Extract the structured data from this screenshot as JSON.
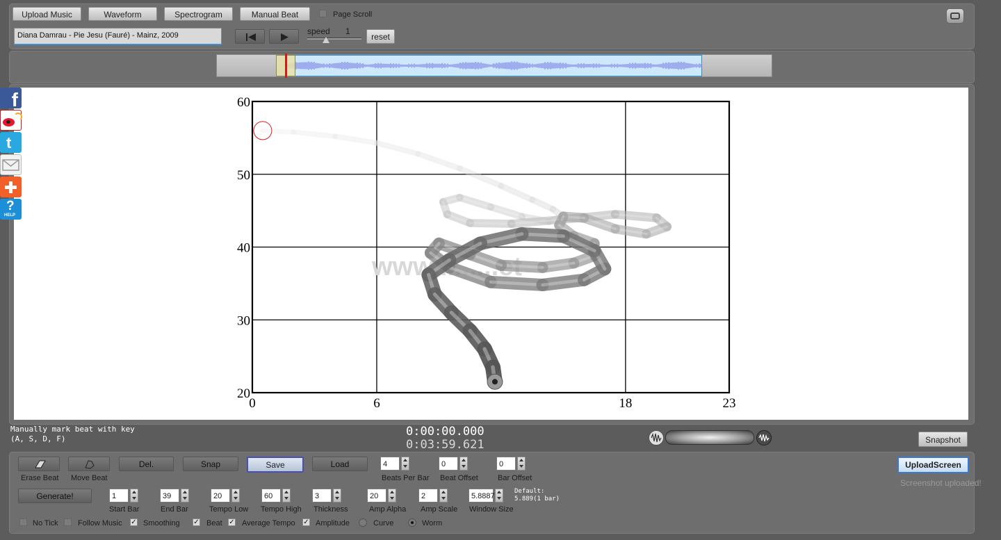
{
  "toolbar": {
    "upload_music": "Upload Music",
    "waveform": "Waveform",
    "spectrogram": "Spectrogram",
    "manual_beat": "Manual Beat",
    "page_scroll": "Page Scroll",
    "track_title": "Diana Damrau - Pie Jesu (Fauré) - Mainz, 2009",
    "speed_label": "speed",
    "speed_value": "1",
    "reset": "reset"
  },
  "chart_data": {
    "type": "line",
    "title": "",
    "xlabel": "",
    "ylabel": "",
    "xlim": [
      0,
      23
    ],
    "ylim": [
      20,
      60
    ],
    "x_ticks": [
      "0",
      "6",
      "18",
      "23"
    ],
    "y_ticks": [
      "60",
      "50",
      "40",
      "30",
      "20"
    ],
    "grid": true,
    "watermark": "www.........et",
    "series": [
      {
        "x": [
          0.5,
          2,
          4,
          6,
          8,
          10,
          12,
          13.5,
          14.5,
          15,
          14.3,
          13,
          11.5,
          10,
          9.2,
          9.4,
          10.5,
          12.5,
          15,
          17.5,
          19.5,
          20,
          19,
          17.5,
          16,
          15,
          14.8,
          15.5,
          16.5,
          16.5,
          15.5,
          14,
          12,
          10.5,
          9,
          8.6,
          9.5,
          11.5,
          14,
          16,
          17,
          16.5,
          15,
          13,
          11,
          9.5,
          8.5,
          8.8,
          9.6,
          10.5,
          11.2,
          11.6,
          11.7
        ],
        "y": [
          56,
          55.8,
          55.2,
          54.3,
          52.8,
          50.8,
          48.4,
          46.5,
          45.2,
          44.2,
          43.5,
          44.2,
          45.5,
          46.8,
          46.2,
          44.5,
          43.3,
          43.2,
          43.8,
          44.5,
          44,
          42.8,
          41.8,
          42.5,
          44,
          44.2,
          43,
          41.5,
          40.5,
          38.8,
          37.8,
          37.2,
          37.5,
          39,
          40.5,
          39.2,
          37.2,
          35.2,
          34.8,
          35.5,
          37,
          39.5,
          41.5,
          41.8,
          40.5,
          38.2,
          36.2,
          33.5,
          31,
          28.5,
          26,
          23.5,
          21.5
        ]
      }
    ]
  },
  "status": {
    "hint_line1": "Manually mark beat with key",
    "hint_line2": "(A, S, D, F)",
    "time_current": "0:00:00.000",
    "time_total": "0:03:59.621",
    "snapshot": "Snapshot"
  },
  "controls": {
    "erase_beat": "Erase Beat",
    "move_beat": "Move Beat",
    "del": "Del.",
    "snap": "Snap",
    "save": "Save",
    "load": "Load",
    "beats_per_bar_label": "Beats Per Bar",
    "beats_per_bar": "4",
    "beat_offset_label": "Beat Offset",
    "beat_offset": "0",
    "bar_offset_label": "Bar Offset",
    "bar_offset": "0",
    "upload_screen": "UploadScreen",
    "screenshot_uploaded": "Screenshot uploaded!",
    "generate": "Generate!",
    "start_bar_label": "Start Bar",
    "start_bar": "1",
    "end_bar_label": "End Bar",
    "end_bar": "39",
    "tempo_low_label": "Tempo Low",
    "tempo_low": "20",
    "tempo_high_label": "Tempo High",
    "tempo_high": "60",
    "thickness_label": "Thickness",
    "thickness": "3",
    "amp_alpha_label": "Amp Alpha",
    "amp_alpha": "20",
    "amp_scale_label": "Amp Scale",
    "amp_scale": "2",
    "window_size_label": "Window Size",
    "window_size": "5.8887",
    "default_line1": "Default:",
    "default_line2": "5.889(1 bar)",
    "no_tick": "No Tick",
    "follow_music": "Follow Music",
    "smoothing": "Smoothing",
    "beat": "Beat",
    "average_tempo": "Average Tempo",
    "amplitude": "Amplitude",
    "curve": "Curve",
    "worm": "Worm",
    "check_mark": "✓"
  },
  "colors": {
    "waveform": "#8085e6",
    "selection": "#cde8fb",
    "playhead": "#d21b1b",
    "facebook": "#3b5998",
    "weibo": "#e6162d",
    "twitter": "#2aa9e0",
    "addthis": "#f2602a",
    "help": "#1c8fd6"
  },
  "social": [
    "facebook-icon",
    "weibo-icon",
    "twitter-icon",
    "email-icon",
    "share-plus-icon",
    "help-icon"
  ]
}
